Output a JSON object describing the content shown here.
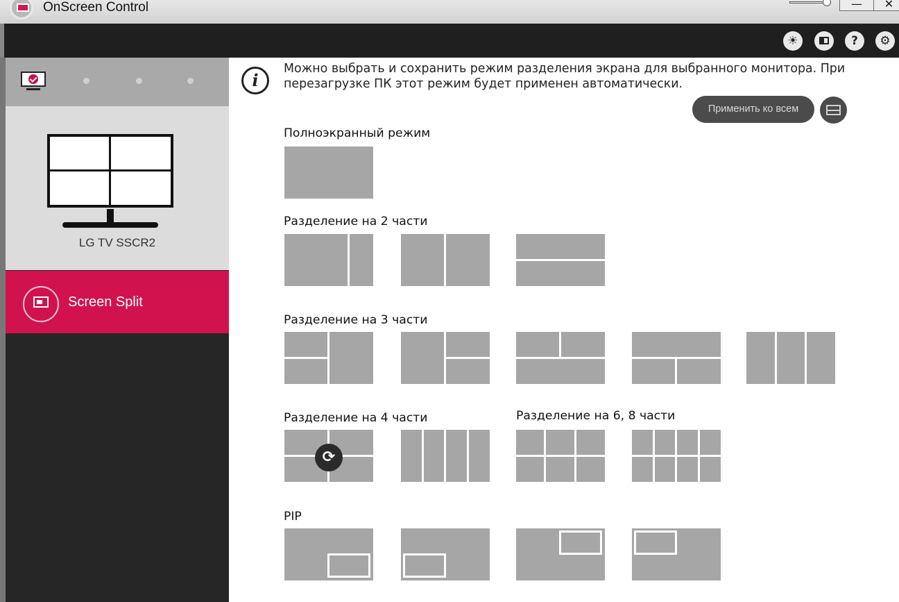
{
  "window": {
    "title": "OnScreen Control",
    "minimize_label": "—",
    "close_label": "✕"
  },
  "toolbar": {
    "icons": [
      "cursor-select-icon",
      "display-icon",
      "help-icon",
      "settings-icon"
    ],
    "help_label": "?",
    "settings_label": "⚙",
    "cursor_label": "☀"
  },
  "sidebar": {
    "monitor_name": "LG TV SSCR2",
    "nav_active_label": "Screen Split",
    "accent": "#d1124e"
  },
  "content": {
    "info_text": "Можно выбрать и сохранить режим разделения экрана для выбранного монитора. При перезагрузке ПК этот режим будет применен автоматически.",
    "info_icon_label": "i",
    "apply_all_label": "Применить ко всем",
    "rotate_label": "⟳",
    "sections": {
      "full": "Полноэкранный режим",
      "split2": "Разделение на 2 части",
      "split3": "Разделение на 3 части",
      "split4": "Разделение на 4 части",
      "split68": "Разделение на 6, 8 части",
      "pip": "PIP"
    }
  }
}
